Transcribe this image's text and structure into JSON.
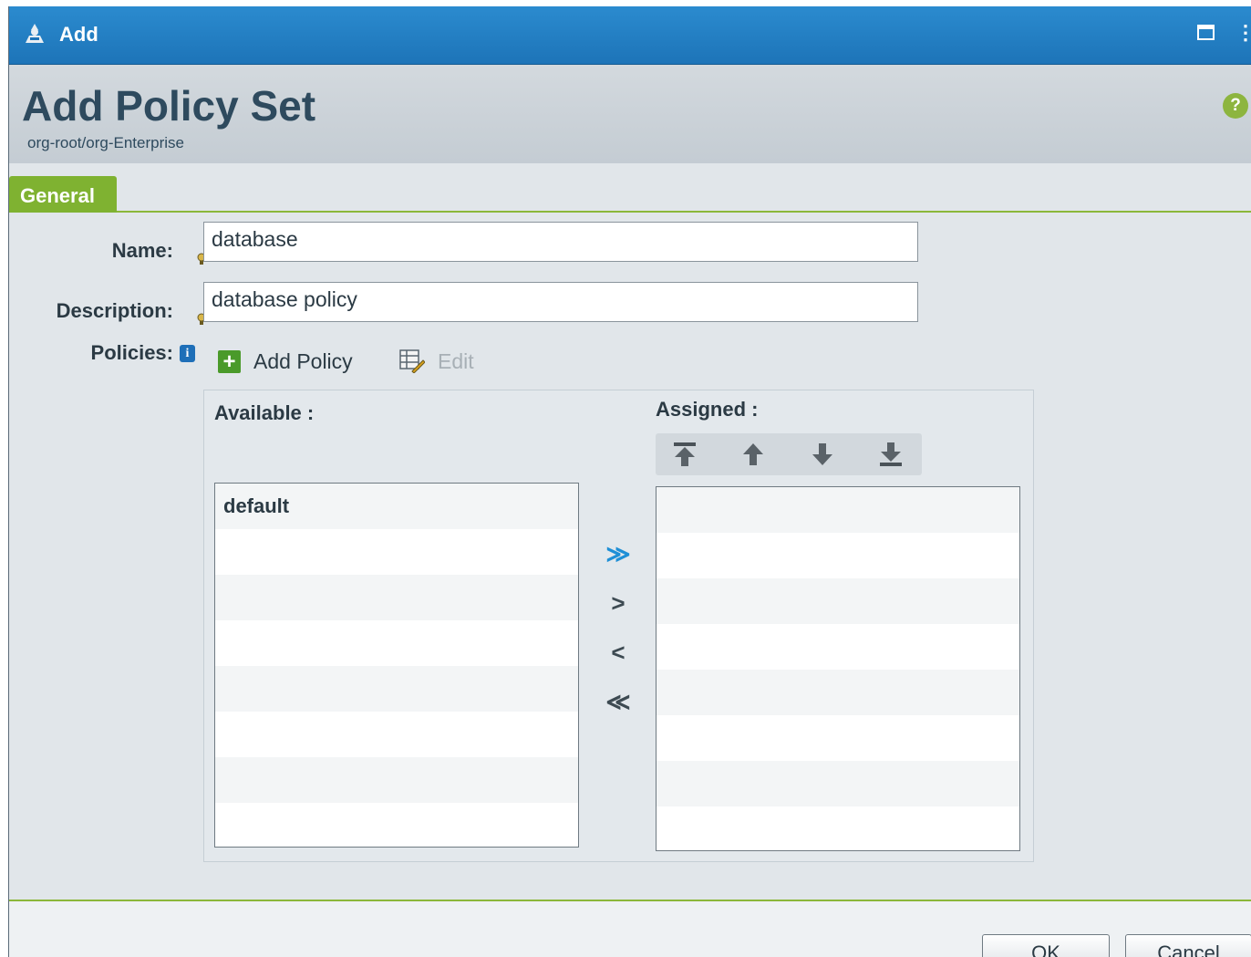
{
  "window": {
    "title": "Add",
    "icon": "admin-user-icon"
  },
  "header": {
    "title": "Add Policy Set",
    "breadcrumb": "org-root/org-Enterprise",
    "help_icon": "?"
  },
  "tabs": [
    {
      "label": "General",
      "active": true
    }
  ],
  "form": {
    "name_label": "Name:",
    "name_value": "database",
    "description_label": "Description:",
    "description_value": "database policy",
    "policies_label": "Policies:",
    "info_icon": "i"
  },
  "policy_toolbar": {
    "add_label": "Add Policy",
    "edit_label": "Edit"
  },
  "available": {
    "label": "Available :",
    "items": [
      "default",
      "",
      "",
      "",
      "",
      "",
      "",
      ""
    ]
  },
  "assigned": {
    "label": "Assigned :",
    "items": [
      "",
      "",
      "",
      "",
      "",
      "",
      "",
      ""
    ]
  },
  "move_buttons": {
    "add_all": "≫",
    "add": ">",
    "remove": "<",
    "remove_all": "≪"
  },
  "footer": {
    "ok_label": "OK",
    "cancel_label": "Cancel"
  },
  "colors": {
    "titlebar": "#2b8bcf",
    "accent_green": "#7fb231",
    "title_text": "#2e4a5e"
  }
}
